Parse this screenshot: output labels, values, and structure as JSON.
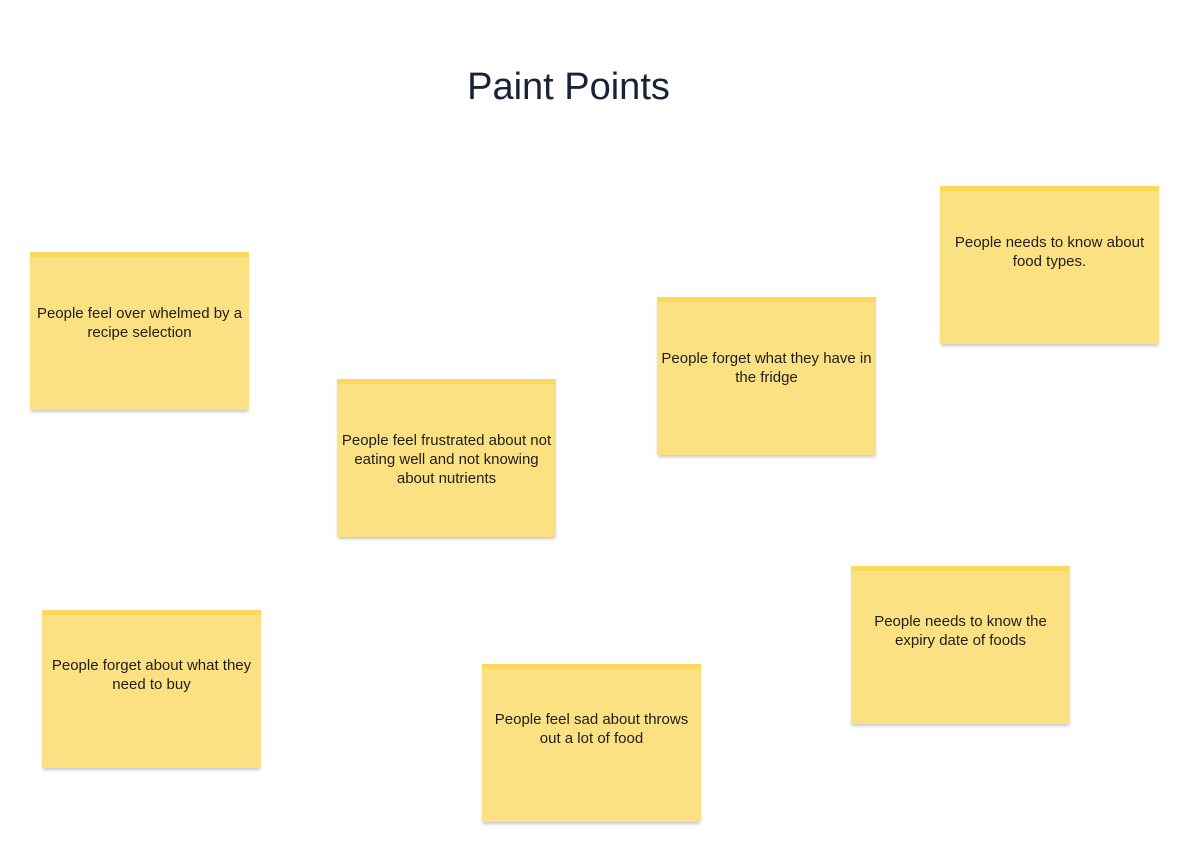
{
  "board": {
    "title": "Paint Points"
  },
  "stickies": [
    {
      "text": "People feel over whelmed by a recipe selection",
      "color": "#fce182"
    },
    {
      "text": "People feel frustrated about not eating well and not knowing about nutrients",
      "color": "#fce182"
    },
    {
      "text": "People forget what they have in the fridge",
      "color": "#fce182"
    },
    {
      "text": "People needs to know about food types.",
      "color": "#fce182"
    },
    {
      "text": "People forget about what they need to buy",
      "color": "#fce182"
    },
    {
      "text": "People feel sad about throws out a lot of food",
      "color": "#fce182"
    },
    {
      "text": "People needs to know the expiry date of foods",
      "color": "#fce182"
    }
  ]
}
